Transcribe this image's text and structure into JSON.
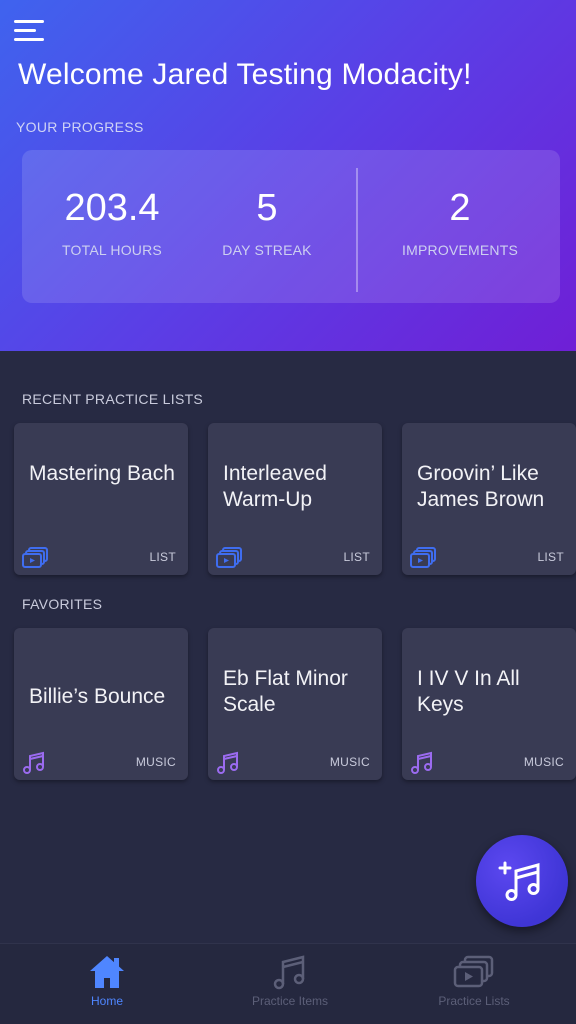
{
  "header": {
    "welcome": "Welcome Jared Testing Modacity!",
    "progress_label": "YOUR PROGRESS"
  },
  "stats": {
    "hours": {
      "value": "203.4",
      "label": "TOTAL HOURS"
    },
    "streak": {
      "value": "5",
      "label": "DAY STREAK"
    },
    "improvements": {
      "value": "2",
      "label": "IMPROVEMENTS"
    }
  },
  "recent": {
    "label": "RECENT PRACTICE LISTS",
    "items": [
      {
        "title": "Mastering Bach",
        "type": "LIST"
      },
      {
        "title": "Interleaved Warm-Up",
        "type": "LIST"
      },
      {
        "title": "Groovin’ Like James Brown",
        "type": "LIST"
      }
    ]
  },
  "favorites": {
    "label": "FAVORITES",
    "items": [
      {
        "title": "Billie’s Bounce",
        "type": "MUSIC"
      },
      {
        "title": "Eb Flat Minor Scale",
        "type": "MUSIC"
      },
      {
        "title": "I IV V In All Keys",
        "type": "MUSIC"
      }
    ]
  },
  "tabs": [
    {
      "label": "Home",
      "icon": "home-icon",
      "active": true
    },
    {
      "label": "Practice Items",
      "icon": "music-note-icon",
      "active": false
    },
    {
      "label": "Practice Lists",
      "icon": "list-stack-icon",
      "active": false
    }
  ],
  "fab": {
    "icon": "add-music-icon"
  },
  "colors": {
    "accent": "#4f86ff",
    "background": "#272a43",
    "card": "#393b54",
    "gradient_start": "#3f63ee",
    "gradient_end": "#6f1fd6",
    "music_icon": "#9b6bf0",
    "list_icon": "#3f6df0"
  }
}
